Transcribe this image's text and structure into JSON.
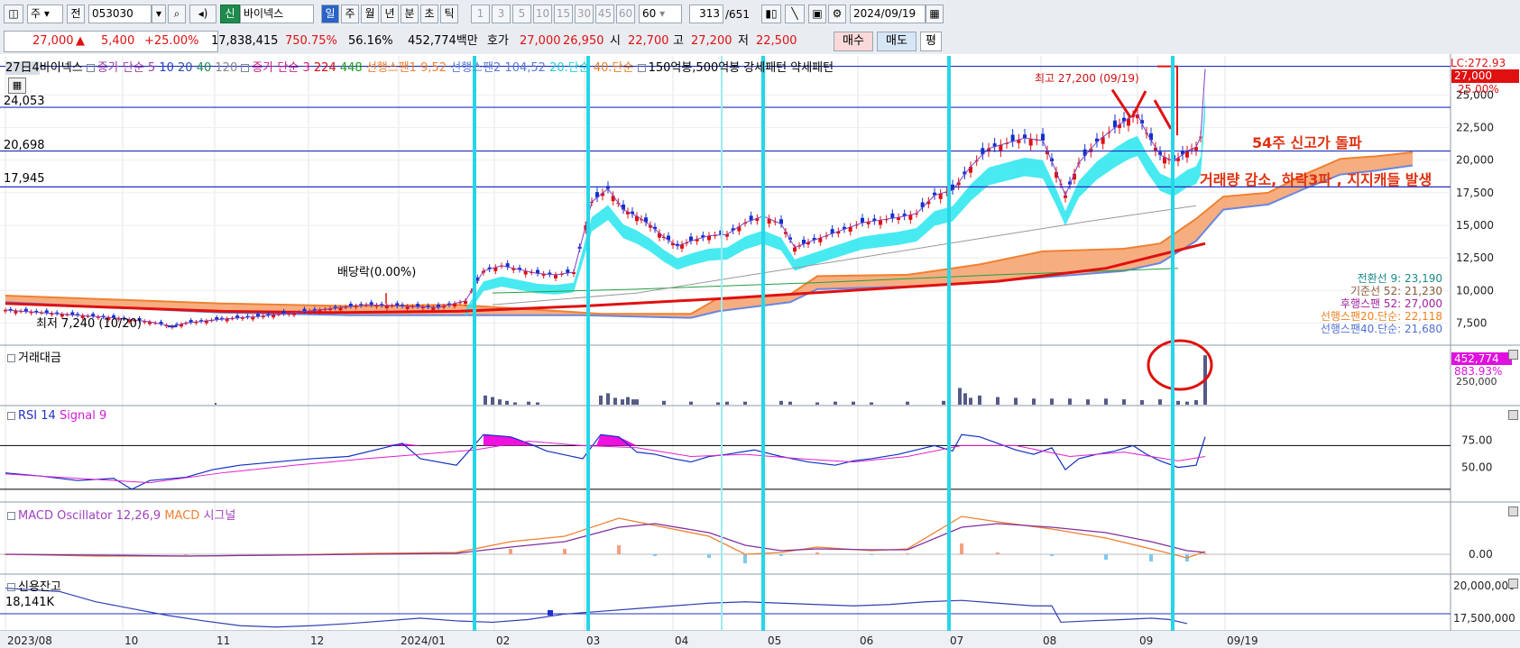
{
  "toolbar": {
    "row1": {
      "period_combo": "주",
      "prev_label": "전",
      "code": "053030",
      "market_badge": "신",
      "stock_name": "바이넥스",
      "intervals": [
        "일",
        "주",
        "월",
        "년",
        "분",
        "초",
        "틱"
      ],
      "active_interval": "일",
      "minute_buttons": [
        "1",
        "3",
        "5",
        "10",
        "15",
        "30",
        "45",
        "60"
      ],
      "minute_select": "60",
      "page_count": "313",
      "page_total": "/651",
      "date": "2024/09/19"
    },
    "row2": {
      "price": "27,000",
      "change": "5,400",
      "change_pct": "+25.00%",
      "volume": "17,838,415",
      "volume_ratio": "750.75%",
      "turnover": "56.16%",
      "amount": "452,774백만",
      "hoga_label": "호가",
      "ask": "27,000",
      "bid": "26,950",
      "open_label": "시",
      "open": "22,700",
      "high_label": "고",
      "high": "27,200",
      "low_label": "저",
      "low": "22,500",
      "buy_label": "매수",
      "sell_label": "매도",
      "avg_label": "평"
    }
  },
  "legend_main": {
    "name": "바이넥스",
    "timeframe": "27日4",
    "ma_close": "종가 단순 5",
    "ma10": "10",
    "ma20": "20",
    "ma40": "40",
    "ma120": "120",
    "ma_close3": "종가 단순 3",
    "ma224": "224",
    "ma448": "448",
    "span1": "선행스팬1 9,52",
    "span2": "선행스팬2 104,52",
    "s20": "20.단순",
    "s40": "40.단순",
    "pattern": "150억봉,500억봉 강세패턴  약세패턴"
  },
  "annotations": {
    "high": "최고 27,200 (09/19)",
    "low": "최저 7,240 (10/20)",
    "dividend": "배당락(0.00%)",
    "text1": "54주 신고가 돌파",
    "text2": "거래량 감소, 하락3파 , 지지캐들 발생"
  },
  "right_labels": {
    "lc": "LC:272.93",
    "price": "27,000",
    "pct": "25.00%",
    "ichimoku": [
      {
        "text": "전환선 9: 23,190",
        "color": "#1a8a8a"
      },
      {
        "text": "기준선 52: 21,230",
        "color": "#8a5a3a"
      },
      {
        "text": "후행스팬 52: 27,000",
        "color": "#a020a0"
      },
      {
        "text": "선행스팬20.단순: 22,118",
        "color": "#f08020"
      },
      {
        "text": "선행스팬40.단순: 21,680",
        "color": "#5070d0"
      }
    ],
    "vol_badge": "452,774",
    "vol_pct": "883.93%",
    "vol_tick": "250,000"
  },
  "horizontal_levels": [
    {
      "label": "24,053",
      "value": 24053
    },
    {
      "label": "20,698",
      "value": 20698
    },
    {
      "label": "17,945",
      "value": 17945
    }
  ],
  "panels": {
    "volume": "거래대금",
    "rsi": "RSI 14",
    "rsi_signal": "Signal 9",
    "macd": "MACD Oscillator 12,26,9",
    "macd_line": "MACD",
    "macd_signal": "시그널",
    "credit": "신용잔고",
    "credit_value": "18,141K"
  },
  "chart_data": {
    "type": "line",
    "title": "",
    "xlabel": "",
    "ylabel": "",
    "x_ticks": [
      "2023/08",
      "10",
      "11",
      "12",
      "2024/01",
      "02",
      "03",
      "04",
      "05",
      "06",
      "07",
      "08",
      "09",
      "09/19"
    ],
    "price_ticks": [
      "25,000",
      "22,500",
      "20,000",
      "17,500",
      "15,000",
      "12,500",
      "10,000",
      "7,500"
    ],
    "ylim": [
      5800,
      28000
    ],
    "rsi_ticks": [
      "75.00",
      "50.00"
    ],
    "macd_ticks": [
      "0.00"
    ],
    "credit_ticks": [
      "20,000,000",
      "17,500,000"
    ],
    "close": [
      [
        0,
        8500
      ],
      [
        40,
        8300
      ],
      [
        80,
        8100
      ],
      [
        120,
        7900
      ],
      [
        160,
        7600
      ],
      [
        185,
        7240
      ],
      [
        200,
        7500
      ],
      [
        240,
        7800
      ],
      [
        280,
        8000
      ],
      [
        320,
        8300
      ],
      [
        360,
        8600
      ],
      [
        400,
        8900
      ],
      [
        440,
        8800
      ],
      [
        480,
        8700
      ],
      [
        510,
        9200
      ],
      [
        530,
        11500
      ],
      [
        550,
        11900
      ],
      [
        570,
        11600
      ],
      [
        590,
        11300
      ],
      [
        610,
        11200
      ],
      [
        630,
        11400
      ],
      [
        650,
        16800
      ],
      [
        668,
        17800
      ],
      [
        685,
        16200
      ],
      [
        700,
        15700
      ],
      [
        715,
        15000
      ],
      [
        730,
        14100
      ],
      [
        745,
        13400
      ],
      [
        760,
        13800
      ],
      [
        780,
        14200
      ],
      [
        800,
        14300
      ],
      [
        820,
        15200
      ],
      [
        840,
        15700
      ],
      [
        860,
        15100
      ],
      [
        875,
        13300
      ],
      [
        890,
        13700
      ],
      [
        910,
        14200
      ],
      [
        930,
        14700
      ],
      [
        950,
        15200
      ],
      [
        970,
        15400
      ],
      [
        990,
        15600
      ],
      [
        1010,
        15900
      ],
      [
        1030,
        17300
      ],
      [
        1050,
        17700
      ],
      [
        1070,
        19500
      ],
      [
        1090,
        20900
      ],
      [
        1110,
        21300
      ],
      [
        1130,
        21700
      ],
      [
        1150,
        21500
      ],
      [
        1165,
        19100
      ],
      [
        1175,
        17300
      ],
      [
        1190,
        19800
      ],
      [
        1210,
        21400
      ],
      [
        1230,
        22500
      ],
      [
        1245,
        23200
      ],
      [
        1255,
        23500
      ],
      [
        1265,
        22100
      ],
      [
        1280,
        20400
      ],
      [
        1295,
        19900
      ],
      [
        1310,
        20700
      ],
      [
        1320,
        21000
      ],
      [
        1325,
        21800
      ],
      [
        1330,
        27000
      ]
    ],
    "span_upper": [
      [
        0,
        9600
      ],
      [
        120,
        9300
      ],
      [
        240,
        9000
      ],
      [
        380,
        8800
      ],
      [
        500,
        8900
      ],
      [
        640,
        8300
      ],
      [
        660,
        8200
      ],
      [
        760,
        8200
      ],
      [
        790,
        9400
      ],
      [
        870,
        9700
      ],
      [
        900,
        11100
      ],
      [
        1000,
        11200
      ],
      [
        1080,
        12000
      ],
      [
        1150,
        13000
      ],
      [
        1240,
        13200
      ],
      [
        1280,
        13600
      ],
      [
        1320,
        15500
      ],
      [
        1350,
        17200
      ],
      [
        1400,
        17500
      ],
      [
        1440,
        18900
      ],
      [
        1480,
        20100
      ],
      [
        1520,
        20300
      ],
      [
        1560,
        20600
      ]
    ],
    "span_lower": [
      [
        0,
        9100
      ],
      [
        120,
        8700
      ],
      [
        240,
        8300
      ],
      [
        380,
        8100
      ],
      [
        500,
        8100
      ],
      [
        640,
        8100
      ],
      [
        700,
        8000
      ],
      [
        760,
        7900
      ],
      [
        790,
        8400
      ],
      [
        870,
        9100
      ],
      [
        900,
        10100
      ],
      [
        1000,
        10300
      ],
      [
        1080,
        10600
      ],
      [
        1150,
        11000
      ],
      [
        1240,
        11500
      ],
      [
        1280,
        12100
      ],
      [
        1320,
        13800
      ],
      [
        1350,
        16200
      ],
      [
        1400,
        16600
      ],
      [
        1440,
        17800
      ],
      [
        1480,
        18900
      ],
      [
        1520,
        19200
      ],
      [
        1560,
        19600
      ]
    ],
    "ma224": [
      [
        0,
        9000
      ],
      [
        120,
        8700
      ],
      [
        240,
        8400
      ],
      [
        360,
        8300
      ],
      [
        500,
        8400
      ],
      [
        640,
        8800
      ],
      [
        800,
        9400
      ],
      [
        960,
        10100
      ],
      [
        1100,
        10700
      ],
      [
        1220,
        11700
      ],
      [
        1330,
        13600
      ]
    ],
    "ma448": [
      [
        540,
        9800
      ],
      [
        700,
        10100
      ],
      [
        900,
        10600
      ],
      [
        1100,
        11200
      ],
      [
        1300,
        11700
      ]
    ],
    "ma120": [
      [
        540,
        8900
      ],
      [
        700,
        9800
      ],
      [
        900,
        12000
      ],
      [
        1100,
        14200
      ],
      [
        1200,
        15300
      ],
      [
        1320,
        16500
      ]
    ],
    "volume_bars": [
      [
        532,
        12
      ],
      [
        540,
        10
      ],
      [
        548,
        7
      ],
      [
        556,
        5
      ],
      [
        565,
        3
      ],
      [
        580,
        4
      ],
      [
        590,
        3
      ],
      [
        660,
        12
      ],
      [
        668,
        15
      ],
      [
        676,
        9
      ],
      [
        684,
        7
      ],
      [
        690,
        10
      ],
      [
        696,
        7
      ],
      [
        700,
        7
      ],
      [
        730,
        5
      ],
      [
        760,
        4
      ],
      [
        790,
        3
      ],
      [
        800,
        4
      ],
      [
        820,
        4
      ],
      [
        840,
        3
      ],
      [
        860,
        5
      ],
      [
        870,
        4
      ],
      [
        900,
        3
      ],
      [
        920,
        4
      ],
      [
        940,
        4
      ],
      [
        960,
        3
      ],
      [
        1000,
        4
      ],
      [
        1040,
        5
      ],
      [
        1058,
        22
      ],
      [
        1064,
        15
      ],
      [
        1070,
        9
      ],
      [
        1080,
        12
      ],
      [
        1100,
        10
      ],
      [
        1120,
        9
      ],
      [
        1140,
        8
      ],
      [
        1160,
        8
      ],
      [
        1180,
        8
      ],
      [
        1200,
        7
      ],
      [
        1220,
        8
      ],
      [
        1240,
        7
      ],
      [
        1260,
        6
      ],
      [
        1280,
        7
      ],
      [
        1300,
        5
      ],
      [
        1310,
        4
      ],
      [
        1320,
        6
      ],
      [
        1330,
        65
      ]
    ],
    "volume_ylim": [
      0,
      70
    ],
    "rsi": [
      [
        0,
        45
      ],
      [
        40,
        42
      ],
      [
        80,
        38
      ],
      [
        120,
        40
      ],
      [
        140,
        30
      ],
      [
        160,
        38
      ],
      [
        200,
        41
      ],
      [
        230,
        48
      ],
      [
        260,
        52
      ],
      [
        300,
        55
      ],
      [
        340,
        58
      ],
      [
        380,
        60
      ],
      [
        420,
        68
      ],
      [
        440,
        72
      ],
      [
        460,
        58
      ],
      [
        500,
        52
      ],
      [
        530,
        80
      ],
      [
        560,
        78
      ],
      [
        580,
        72
      ],
      [
        600,
        65
      ],
      [
        640,
        58
      ],
      [
        660,
        80
      ],
      [
        680,
        78
      ],
      [
        700,
        64
      ],
      [
        720,
        62
      ],
      [
        740,
        58
      ],
      [
        760,
        55
      ],
      [
        780,
        60
      ],
      [
        800,
        62
      ],
      [
        830,
        66
      ],
      [
        860,
        60
      ],
      [
        890,
        55
      ],
      [
        920,
        52
      ],
      [
        940,
        56
      ],
      [
        960,
        58
      ],
      [
        990,
        62
      ],
      [
        1010,
        66
      ],
      [
        1030,
        70
      ],
      [
        1050,
        65
      ],
      [
        1060,
        80
      ],
      [
        1080,
        78
      ],
      [
        1100,
        72
      ],
      [
        1120,
        66
      ],
      [
        1140,
        62
      ],
      [
        1160,
        68
      ],
      [
        1175,
        48
      ],
      [
        1190,
        58
      ],
      [
        1210,
        62
      ],
      [
        1230,
        65
      ],
      [
        1250,
        70
      ],
      [
        1265,
        62
      ],
      [
        1280,
        56
      ],
      [
        1300,
        50
      ],
      [
        1320,
        52
      ],
      [
        1330,
        78
      ]
    ],
    "rsi_signal_line": [
      [
        0,
        44
      ],
      [
        80,
        40
      ],
      [
        160,
        36
      ],
      [
        240,
        45
      ],
      [
        320,
        52
      ],
      [
        400,
        58
      ],
      [
        460,
        62
      ],
      [
        520,
        66
      ],
      [
        580,
        74
      ],
      [
        640,
        70
      ],
      [
        700,
        68
      ],
      [
        760,
        60
      ],
      [
        820,
        62
      ],
      [
        880,
        58
      ],
      [
        940,
        55
      ],
      [
        1000,
        60
      ],
      [
        1060,
        70
      ],
      [
        1120,
        70
      ],
      [
        1180,
        60
      ],
      [
        1240,
        64
      ],
      [
        1300,
        56
      ],
      [
        1330,
        60
      ]
    ],
    "rsi_ylim": [
      20,
      100
    ],
    "macd_line": [
      [
        0,
        0
      ],
      [
        100,
        -2
      ],
      [
        200,
        -2
      ],
      [
        300,
        -1
      ],
      [
        400,
        1
      ],
      [
        500,
        2
      ],
      [
        560,
        14
      ],
      [
        620,
        20
      ],
      [
        680,
        40
      ],
      [
        720,
        32
      ],
      [
        780,
        20
      ],
      [
        820,
        0
      ],
      [
        860,
        2
      ],
      [
        900,
        8
      ],
      [
        960,
        4
      ],
      [
        1000,
        6
      ],
      [
        1060,
        42
      ],
      [
        1100,
        36
      ],
      [
        1160,
        28
      ],
      [
        1220,
        18
      ],
      [
        1270,
        6
      ],
      [
        1310,
        -4
      ],
      [
        1330,
        3
      ]
    ],
    "macd_signal_line": [
      [
        0,
        0
      ],
      [
        100,
        -1
      ],
      [
        200,
        -2
      ],
      [
        300,
        -1
      ],
      [
        400,
        0
      ],
      [
        500,
        1
      ],
      [
        560,
        8
      ],
      [
        620,
        14
      ],
      [
        680,
        30
      ],
      [
        720,
        34
      ],
      [
        780,
        24
      ],
      [
        820,
        10
      ],
      [
        860,
        4
      ],
      [
        900,
        6
      ],
      [
        960,
        5
      ],
      [
        1000,
        5
      ],
      [
        1060,
        30
      ],
      [
        1100,
        34
      ],
      [
        1160,
        30
      ],
      [
        1220,
        24
      ],
      [
        1270,
        14
      ],
      [
        1310,
        4
      ],
      [
        1330,
        2
      ]
    ],
    "macd_ylim": [
      -20,
      50
    ],
    "credit": [
      [
        0,
        60
      ],
      [
        60,
        55
      ],
      [
        100,
        40
      ],
      [
        140,
        30
      ],
      [
        180,
        20
      ],
      [
        220,
        12
      ],
      [
        260,
        5
      ],
      [
        300,
        3
      ],
      [
        340,
        5
      ],
      [
        380,
        8
      ],
      [
        420,
        12
      ],
      [
        460,
        16
      ],
      [
        500,
        12
      ],
      [
        540,
        10
      ],
      [
        580,
        14
      ],
      [
        620,
        22
      ],
      [
        660,
        26
      ],
      [
        700,
        30
      ],
      [
        740,
        34
      ],
      [
        780,
        38
      ],
      [
        820,
        40
      ],
      [
        860,
        38
      ],
      [
        900,
        36
      ],
      [
        940,
        34
      ],
      [
        980,
        36
      ],
      [
        1020,
        40
      ],
      [
        1060,
        42
      ],
      [
        1100,
        38
      ],
      [
        1140,
        34
      ],
      [
        1160,
        34
      ],
      [
        1170,
        10
      ],
      [
        1200,
        12
      ],
      [
        1240,
        14
      ],
      [
        1270,
        16
      ],
      [
        1290,
        14
      ],
      [
        1310,
        8
      ]
    ],
    "credit_ylim": [
      0,
      70
    ]
  }
}
